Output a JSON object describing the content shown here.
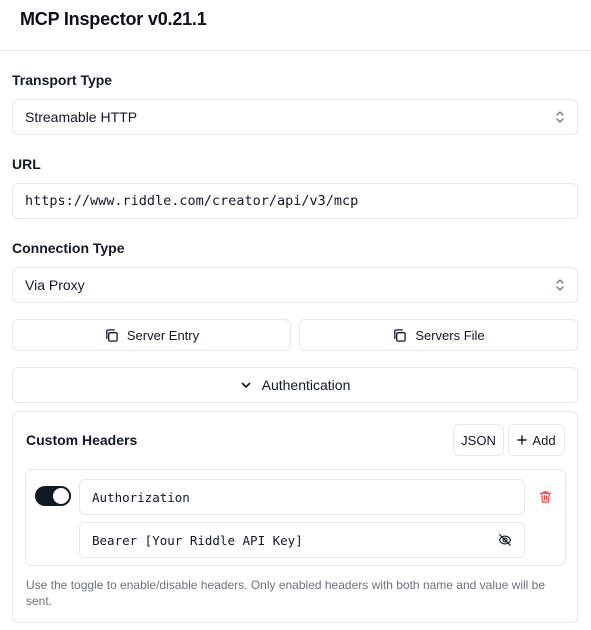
{
  "app": {
    "title": "MCP Inspector v0.21.1"
  },
  "transport": {
    "label": "Transport Type",
    "value": "Streamable HTTP"
  },
  "url": {
    "label": "URL",
    "value": "https://www.riddle.com/creator/api/v3/mcp"
  },
  "connection": {
    "label": "Connection Type",
    "value": "Via Proxy"
  },
  "actions": {
    "server_entry": "Server Entry",
    "servers_file": "Servers File"
  },
  "auth": {
    "label": "Authentication",
    "icon": "chevron-down-icon"
  },
  "custom_headers": {
    "title": "Custom Headers",
    "json_button": "JSON",
    "add_button": "Add",
    "headers": [
      {
        "enabled": true,
        "name": "Authorization",
        "value": "Bearer [Your Riddle API Key]"
      }
    ],
    "hint": "Use the toggle to enable/disable headers. Only enabled headers with both name and value will be sent."
  },
  "colors": {
    "danger": "#ef4444",
    "border": "#e2e8f0",
    "toggle_on": "#111827",
    "muted_text": "#6b7280"
  }
}
